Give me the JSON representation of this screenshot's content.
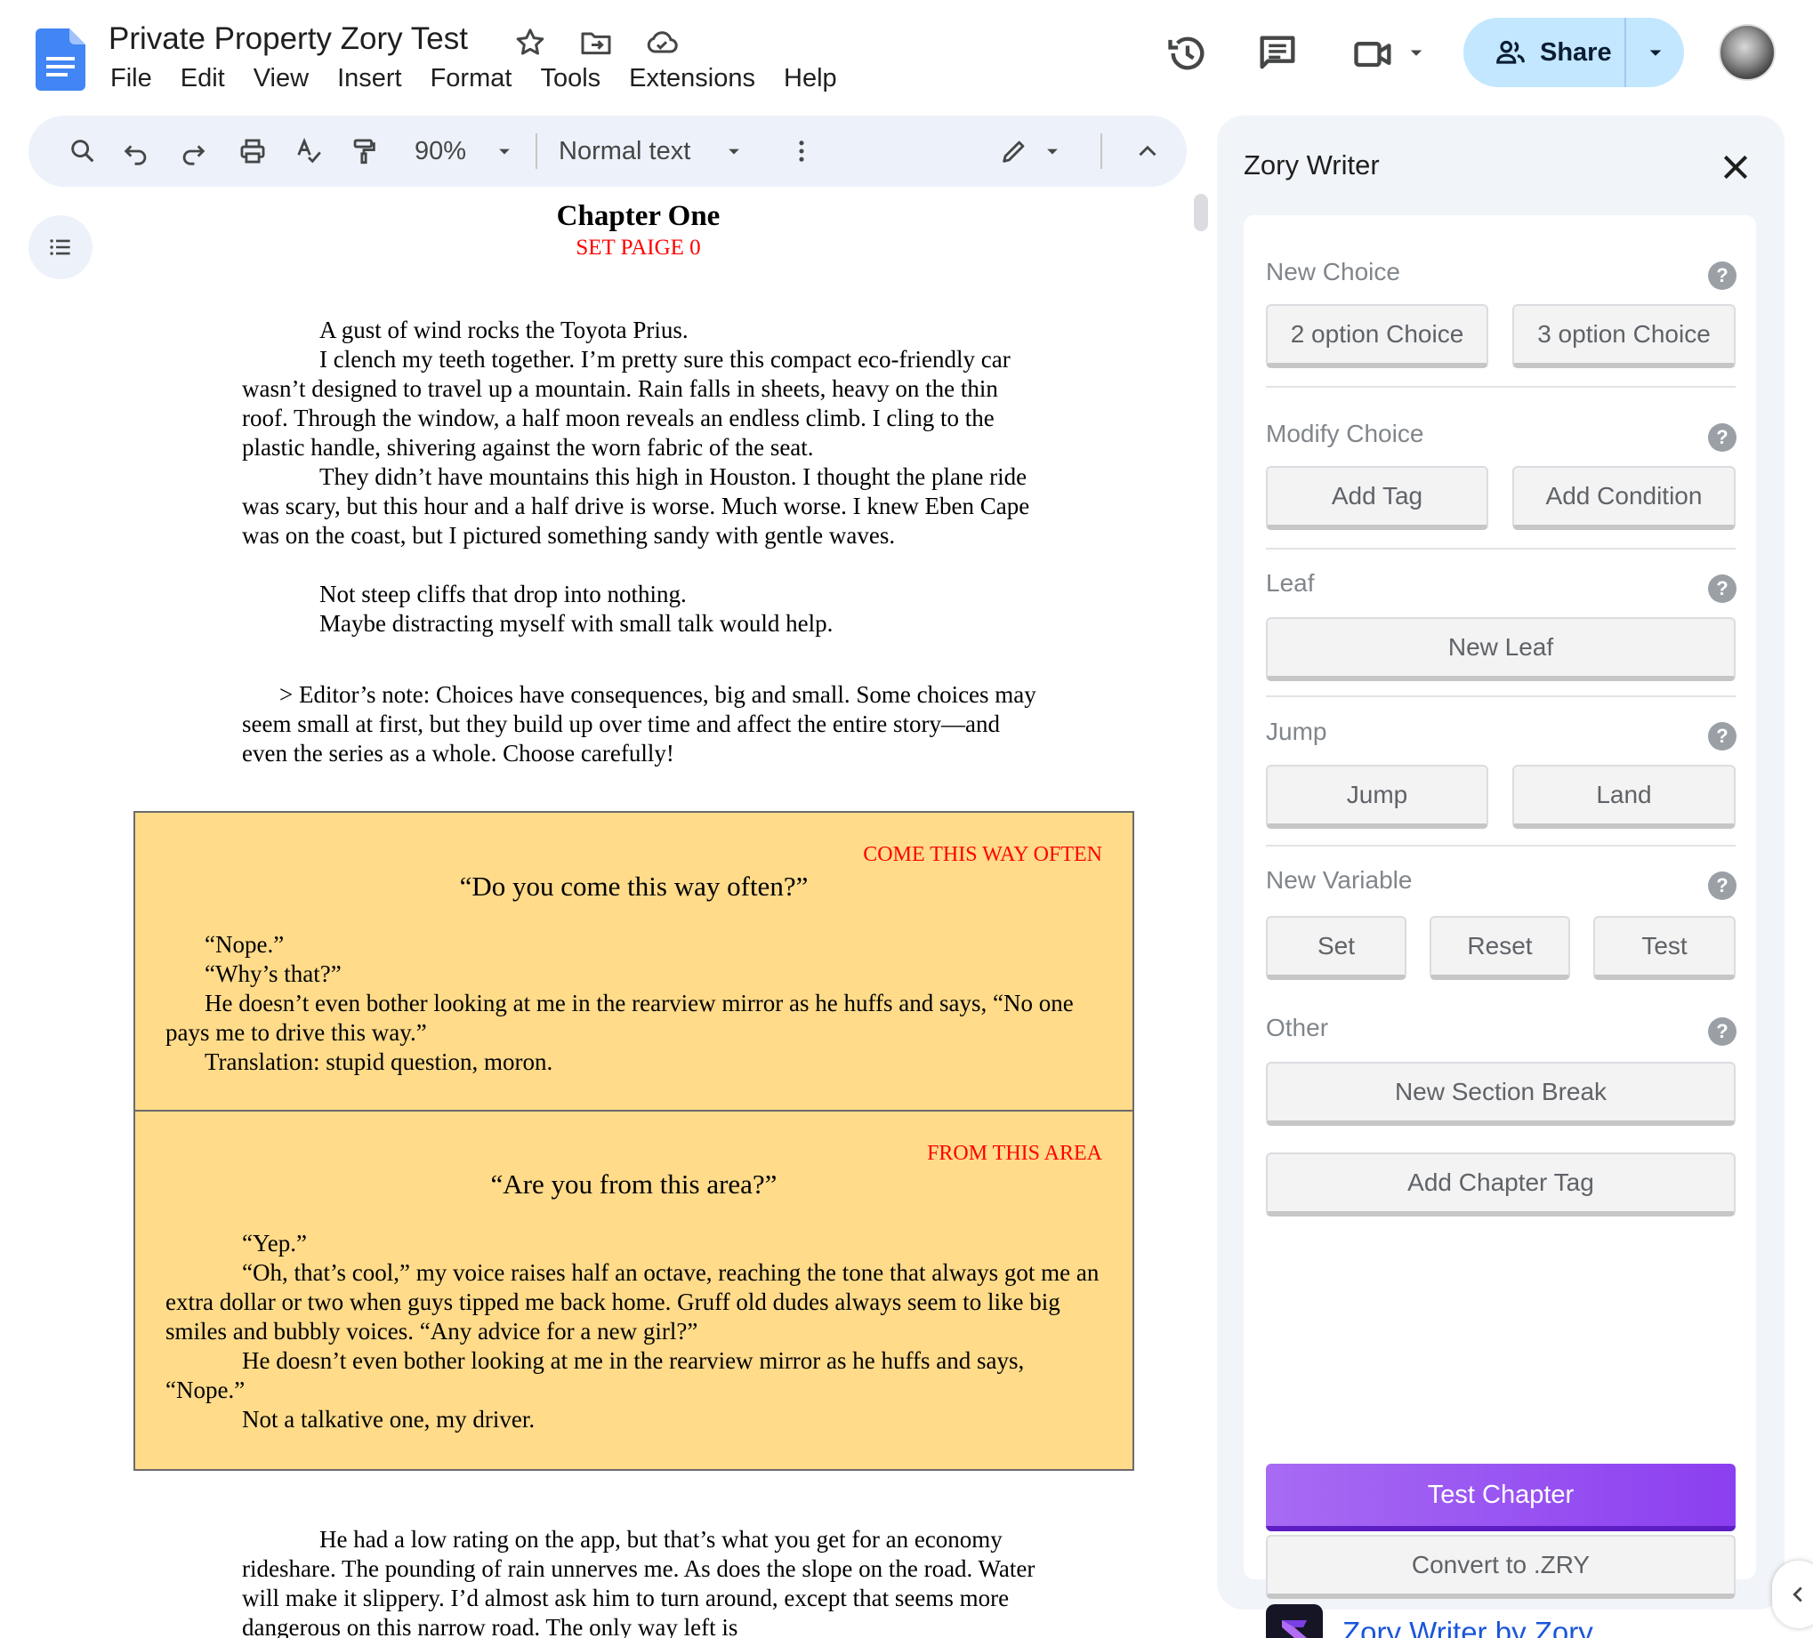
{
  "header": {
    "title": "Private Property Zory Test",
    "menu": [
      "File",
      "Edit",
      "View",
      "Insert",
      "Format",
      "Tools",
      "Extensions",
      "Help"
    ],
    "share_label": "Share"
  },
  "toolbar": {
    "zoom": "90%",
    "style": "Normal text"
  },
  "document": {
    "chapter_title": "Chapter One",
    "chapter_tag": "SET PAIGE 0",
    "paragraphs": [
      "A gust of wind rocks the Toyota Prius.",
      "I clench my teeth together. I’m pretty sure this compact eco-friendly car wasn’t designed to travel up a mountain. Rain falls in sheets, heavy on the thin roof. Through the window, a half moon reveals an endless climb. I cling to the plastic handle, shivering against the worn fabric of the seat.",
      "They didn’t have mountains this high in Houston. I thought the plane ride was scary, but this hour and a half drive is worse. Much worse. I knew Eben Cape was on the coast, but I pictured something sandy with gentle waves.",
      "Not steep cliffs that drop into nothing.",
      "Maybe distracting myself with small talk would help."
    ],
    "editor_note": "> Editor’s note: Choices have consequences, big and small. Some choices may seem small at first, but they build up over time and affect the entire story—and even the series as a whole. Choose carefully!",
    "choices": [
      {
        "tag": "COME THIS WAY OFTEN",
        "title": "“Do you come this way often?”",
        "lines": [
          "“Nope.”",
          "“Why’s that?”",
          "He doesn’t even bother looking at me in the rearview mirror as he huffs and says, “No one pays me to drive this way.”",
          "Translation: stupid question, moron."
        ]
      },
      {
        "tag": "FROM THIS AREA",
        "title": "“Are you from this area?”",
        "lines": [
          "“Yep.”",
          "“Oh, that’s cool,” my voice raises half an octave, reaching the tone that always got me an extra dollar or two when guys tipped me back home. Gruff old dudes always seem to like big smiles and bubbly voices. “Any advice for a new girl?”",
          "He doesn’t even bother looking at me in the rearview mirror as he huffs and says, “Nope.”",
          "Not a talkative one, my driver."
        ]
      }
    ],
    "tail": "He had a low rating on the app, but that’s what you get for an economy rideshare. The pounding of rain unnerves me. As does the slope on the road. Water will make it slippery. I’d almost ask him to turn around, except that seems more dangerous on this narrow road. The only way left is"
  },
  "panel": {
    "title": "Zory Writer",
    "sections": {
      "new_choice": {
        "label": "New Choice",
        "buttons": [
          "2 option Choice",
          "3 option Choice"
        ]
      },
      "modify_choice": {
        "label": "Modify Choice",
        "buttons": [
          "Add Tag",
          "Add Condition"
        ]
      },
      "leaf": {
        "label": "Leaf",
        "buttons": [
          "New Leaf"
        ]
      },
      "jump": {
        "label": "Jump",
        "buttons": [
          "Jump",
          "Land"
        ]
      },
      "new_variable": {
        "label": "New Variable",
        "buttons": [
          "Set",
          "Reset",
          "Test"
        ]
      },
      "other": {
        "label": "Other",
        "buttons": [
          "New Section Break",
          "Add Chapter Tag"
        ]
      }
    },
    "test_chapter": "Test Chapter",
    "convert": "Convert to .ZRY",
    "brand": "Zory Writer by Zory"
  },
  "colors": {
    "accent": "#c2e7ff",
    "choice_bg": "#ffdb8a",
    "tag_red": "#ff0000",
    "purple": "#8b3ff0",
    "brand_blue": "#1a56d9"
  },
  "icons": [
    "docs-icon",
    "star-icon",
    "move-folder-icon",
    "cloud-saved-icon",
    "history-icon",
    "comments-icon",
    "meet-icon",
    "share-people-icon",
    "search-icon",
    "undo-icon",
    "redo-icon",
    "print-icon",
    "spellcheck-icon",
    "paint-format-icon",
    "more-vert-icon",
    "edit-pencil-icon",
    "chevron-up-icon",
    "outline-icon",
    "close-icon",
    "help-icon",
    "chevron-left-icon"
  ]
}
